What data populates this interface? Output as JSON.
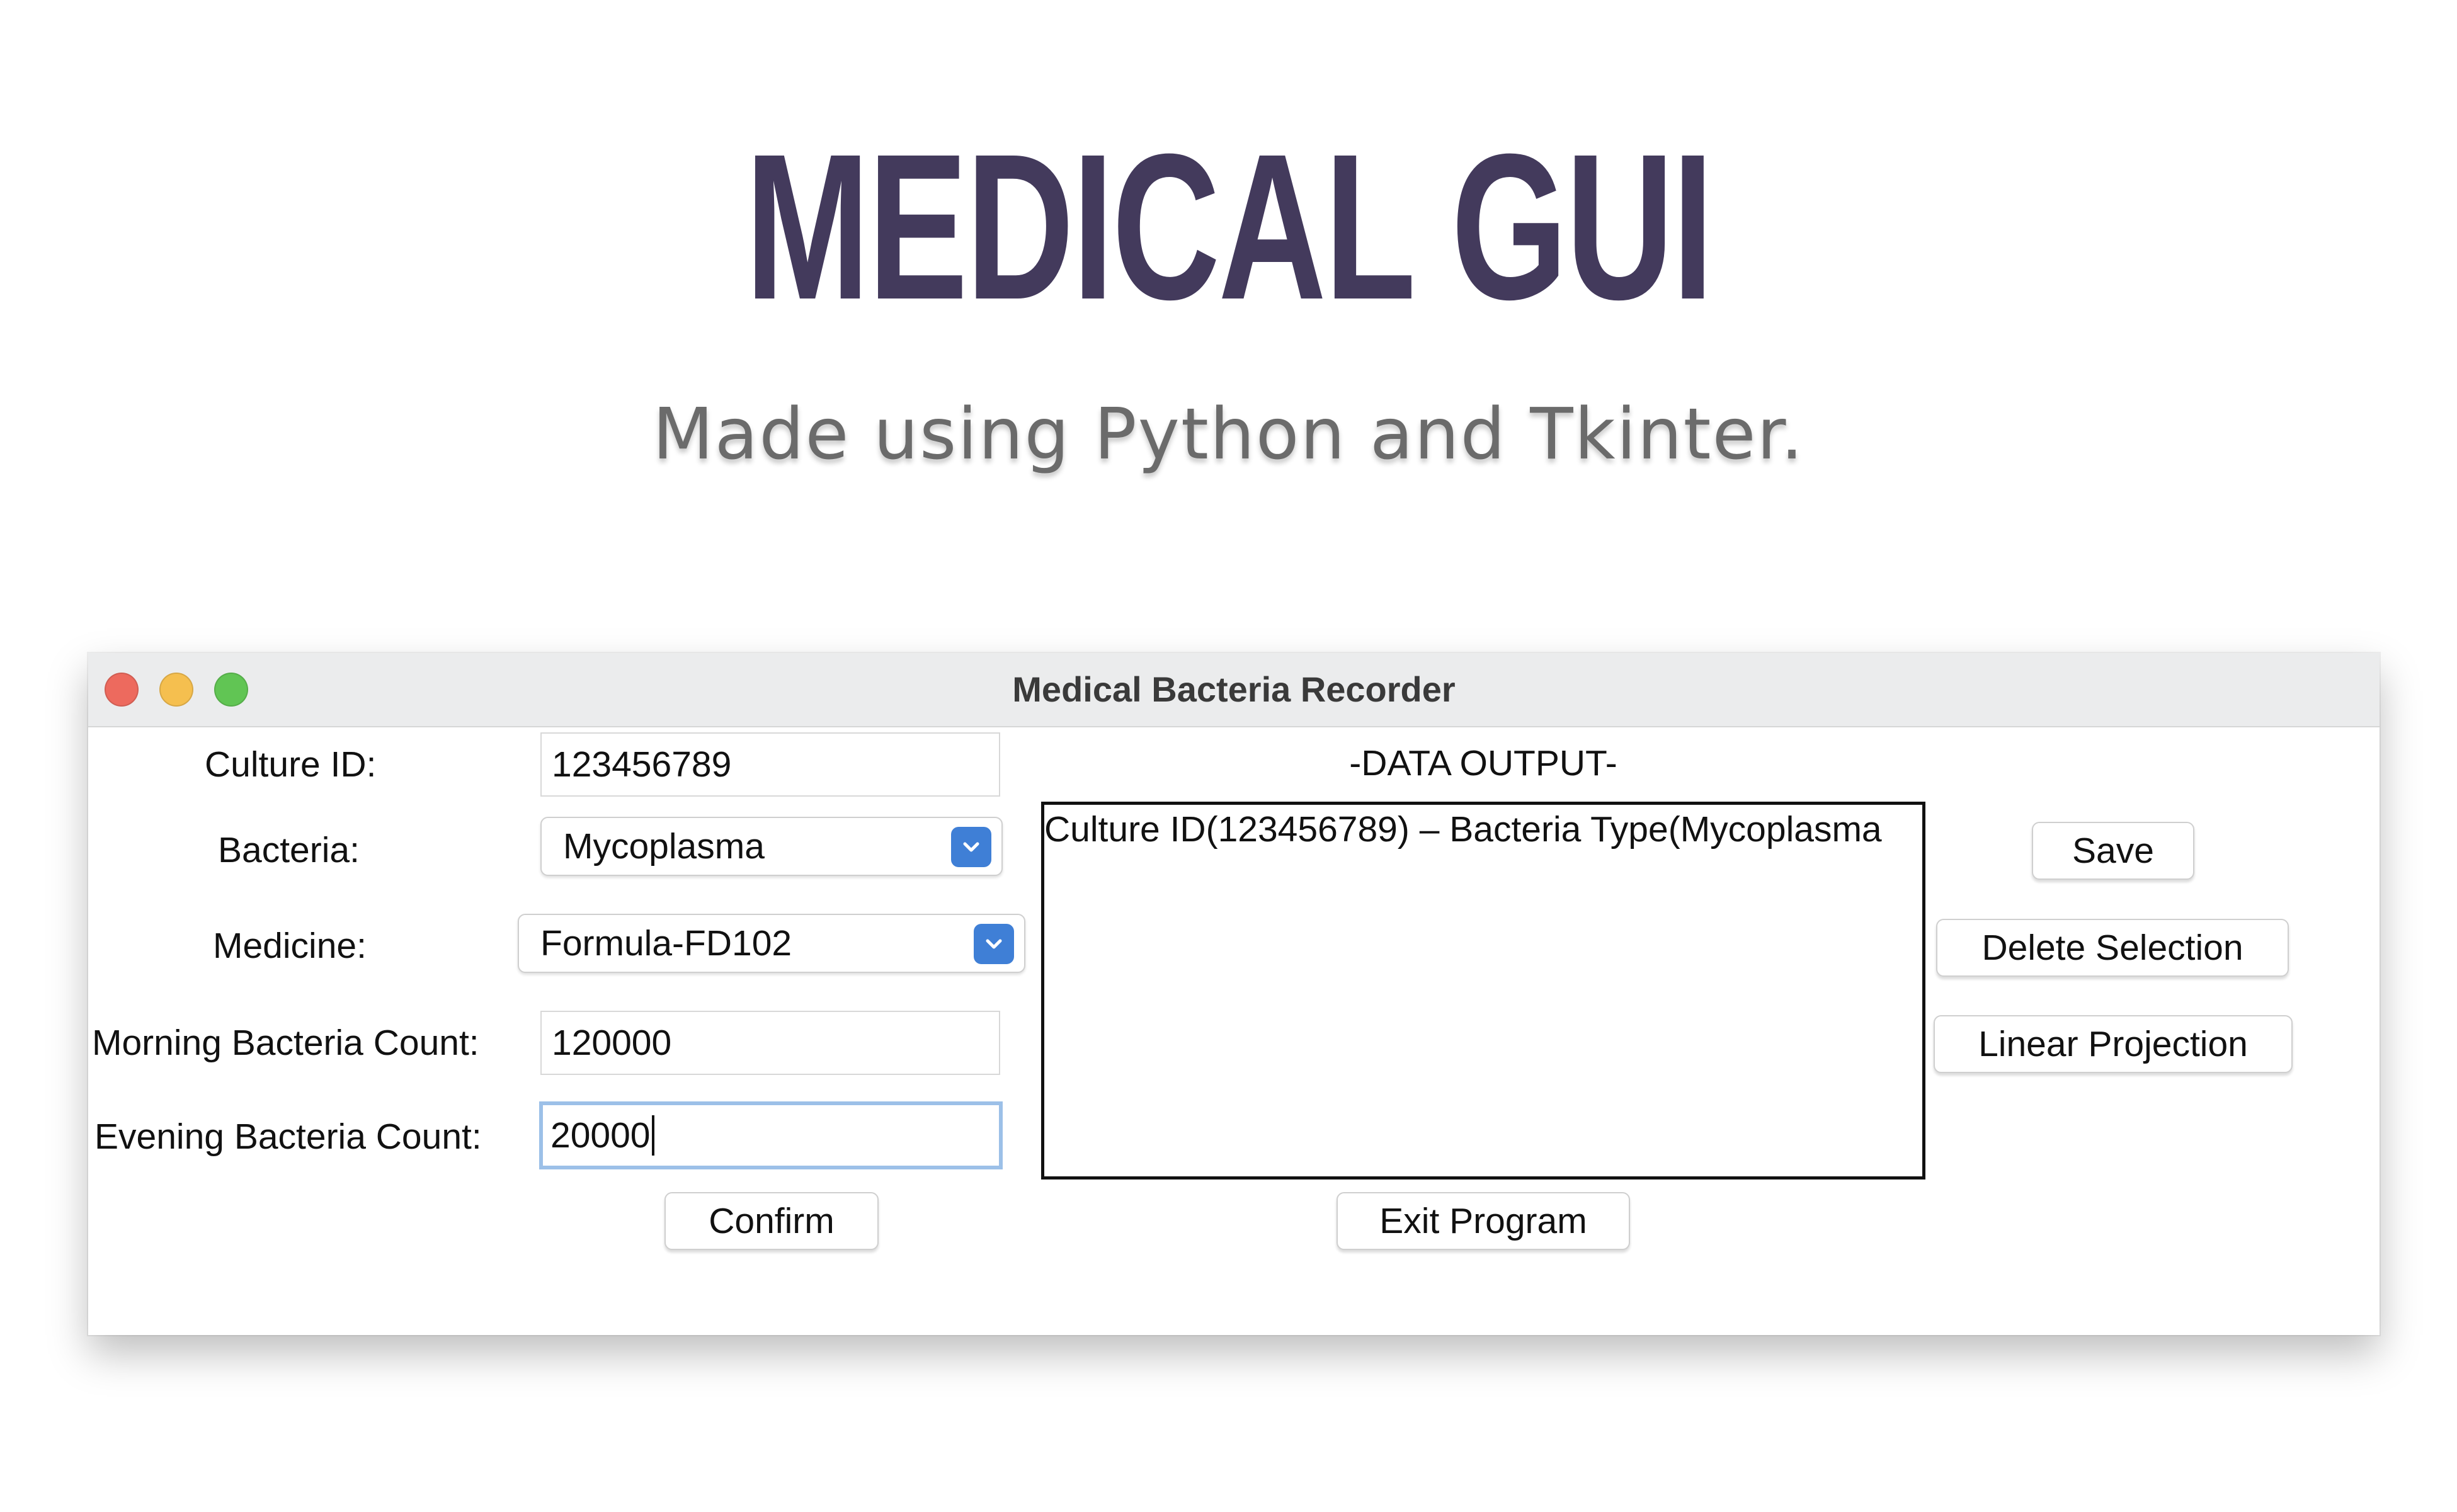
{
  "hero": {
    "title": "MEDICAL GUI",
    "subtitle": "Made using Python and Tkinter."
  },
  "window": {
    "title": "Medical Bacteria Recorder",
    "traffic_lights": {
      "close_color": "#ed6a5e",
      "minimize_color": "#f5bf4f",
      "zoom_color": "#61c554"
    }
  },
  "form": {
    "culture_id": {
      "label": "Culture ID:",
      "value": "123456789"
    },
    "bacteria": {
      "label": "Bacteria:",
      "value": "Mycoplasma"
    },
    "medicine": {
      "label": "Medicine:",
      "value": "Formula-FD102"
    },
    "morning_count": {
      "label": "Morning Bacteria Count:",
      "value": "120000"
    },
    "evening_count": {
      "label": "Evening Bacteria Count:",
      "value": "20000"
    },
    "confirm_label": "Confirm"
  },
  "output": {
    "title": "-DATA OUTPUT-",
    "lines": [
      "Culture ID(123456789) – Bacteria Type(Mycoplasma"
    ],
    "exit_label": "Exit Program"
  },
  "actions": {
    "save_label": "Save",
    "delete_label": "Delete Selection",
    "projection_label": "Linear Projection"
  },
  "colors": {
    "hero_title": "#433a5c",
    "accent": "#3f7fd6",
    "focus_ring": "#9cc0e8"
  }
}
